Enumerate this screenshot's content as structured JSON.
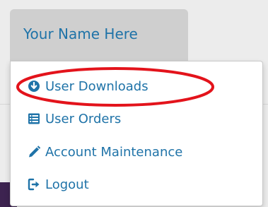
{
  "user_menu": {
    "name": "Your Name Here"
  },
  "dropdown": {
    "items": [
      {
        "label": "User Downloads",
        "icon": "download-circle-icon"
      },
      {
        "label": "User Orders",
        "icon": "list-alt-icon"
      },
      {
        "label": "Account Maintenance",
        "icon": "pencil-icon"
      },
      {
        "label": "Logout",
        "icon": "logout-icon"
      }
    ]
  },
  "colors": {
    "link": "#1f73a8",
    "highlight_ring": "#e3131b",
    "toggle_bg": "#cfcfcf",
    "footer_strip": "#3d2350"
  }
}
